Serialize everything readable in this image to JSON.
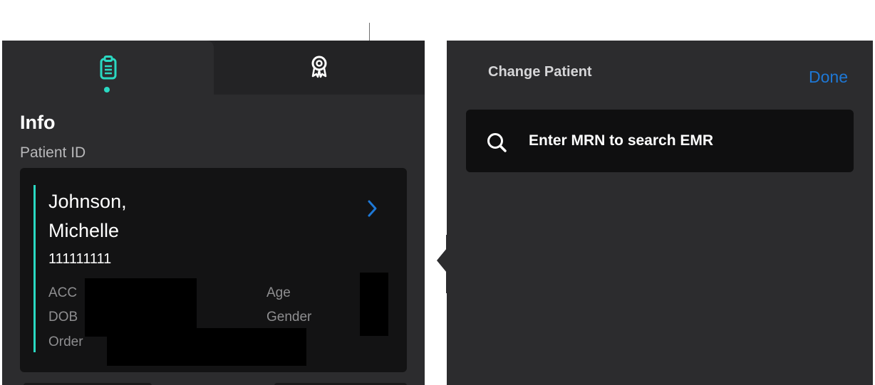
{
  "tabs": [
    {
      "icon": "clipboard-icon",
      "active": true
    },
    {
      "icon": "award-ribbon-icon",
      "active": false
    }
  ],
  "info": {
    "title": "Info",
    "patient_id_label": "Patient ID"
  },
  "patient": {
    "name": "Johnson,\nMichelle",
    "mrn": "111111111",
    "labels": {
      "acc": "ACC",
      "dob": "DOB",
      "order": "Order",
      "age": "Age",
      "gender": "Gender"
    }
  },
  "change_patient": {
    "title": "Change Patient",
    "done_label": "Done",
    "search_placeholder": "Enter MRN to search EMR"
  },
  "colors": {
    "accent": "#2ad9c2",
    "link": "#1e78d6",
    "panel": "#2c2c2e"
  }
}
